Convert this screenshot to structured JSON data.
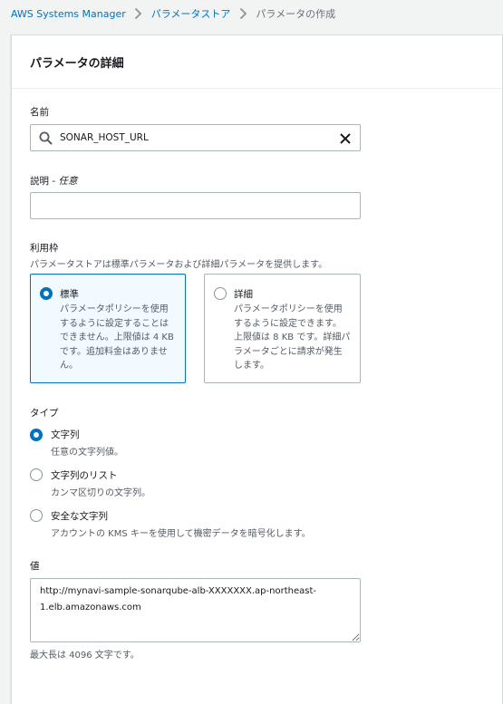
{
  "breadcrumb": {
    "items": [
      "AWS Systems Manager",
      "パラメータストア"
    ],
    "current": "パラメータの作成"
  },
  "panel": {
    "title": "パラメータの詳細"
  },
  "name": {
    "label": "名前",
    "value": "SONAR_HOST_URL"
  },
  "description": {
    "label": "説明 - ",
    "optional": "任意",
    "value": ""
  },
  "tier": {
    "label": "利用枠",
    "help": "パラメータストアは標準パラメータおよび詳細パラメータを提供します。",
    "options": [
      {
        "title": "標準",
        "desc_lines": [
          "パラメータポリシーを使用",
          "するように設定することは",
          "できません。上限値は 4 KB",
          "です。追加料金はありませ",
          "ん。"
        ],
        "selected": true
      },
      {
        "title": "詳細",
        "desc_lines": [
          "パラメータポリシーを使用",
          "するように設定できます。",
          "上限値は 8 KB です。詳細パ",
          "ラメータごとに請求が発生",
          "します。"
        ],
        "selected": false
      }
    ]
  },
  "type": {
    "label": "タイプ",
    "options": [
      {
        "title": "文字列",
        "desc": "任意の文字列値。",
        "selected": true
      },
      {
        "title": "文字列のリスト",
        "desc": "カンマ区切りの文字列。",
        "selected": false
      },
      {
        "title": "安全な文字列",
        "desc": "アカウントの KMS キーを使用して機密データを暗号化します。",
        "selected": false
      }
    ]
  },
  "value": {
    "label": "値",
    "text": "http://mynavi-sample-sonarqube-alb-XXXXXXX.ap-northeast-1.elb.amazonaws.com",
    "constraint": "最大長は 4096 文字です。"
  },
  "colors": {
    "accent": "#0073bb",
    "link": "#0073bb",
    "selected_tile_bg": "#f1faff"
  }
}
